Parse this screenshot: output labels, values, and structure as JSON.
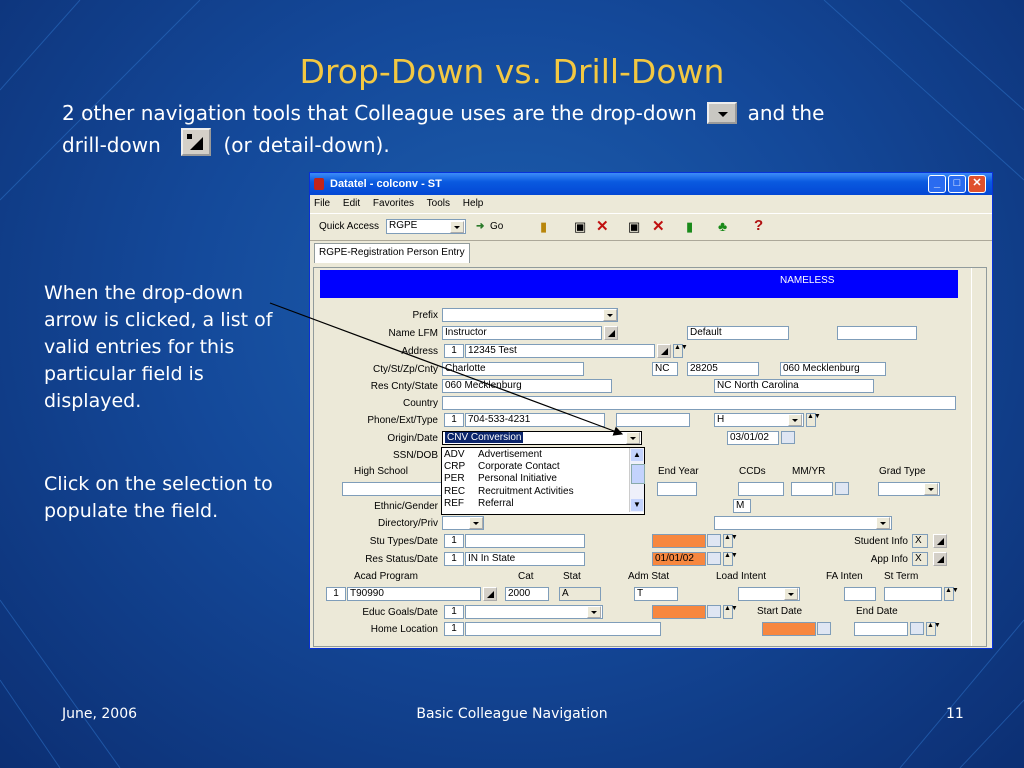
{
  "slide": {
    "title": "Drop-Down vs. Drill-Down",
    "intro_part1": "2 other navigation tools that Colleague uses are the drop-down",
    "intro_part2": "and the",
    "intro_part3": "drill-down",
    "intro_part4": "(or detail-down).",
    "side_text1": "When the drop-down arrow is clicked, a list of valid entries for this particular field is displayed.",
    "side_text2": "Click on the selection to populate the field.",
    "footer_left": "June, 2006",
    "footer_center": "Basic Colleague Navigation",
    "footer_right": "11"
  },
  "window": {
    "title": "Datatel - colconv - ST",
    "menu": [
      "File",
      "Edit",
      "Favorites",
      "Tools",
      "Help"
    ],
    "quick_access_label": "Quick Access",
    "quick_access_value": "RGPE",
    "go_label": "Go",
    "tab_label": "RGPE-Registration Person Entry",
    "banner_text": "NAMELESS"
  },
  "form": {
    "labels": {
      "prefix": "Prefix",
      "name": "Name LFM",
      "address": "Address",
      "city": "Cty/St/Zp/Cnty",
      "res_cnty": "Res Cnty/State",
      "country": "Country",
      "phone": "Phone/Ext/Type",
      "origin": "Origin/Date",
      "ssn": "SSN/DOB",
      "high_school": "High School",
      "end_year": "End Year",
      "ccds": "CCDs",
      "mmyr": "MM/YR",
      "grad_type": "Grad Type",
      "ethnic": "Ethnic/Gender",
      "directory": "Directory/Priv",
      "stu_types": "Stu Types/Date",
      "student_info": "Student Info",
      "res_status": "Res Status/Date",
      "app_info": "App Info",
      "acad_program": "Acad Program",
      "cat": "Cat",
      "stat": "Stat",
      "adm_stat": "Adm Stat",
      "load_intent": "Load Intent",
      "fa_inten": "FA Inten",
      "st_term": "St Term",
      "educ_goals": "Educ Goals/Date",
      "start_date": "Start Date",
      "end_date": "End Date",
      "home_location": "Home Location"
    },
    "values": {
      "name": "Instructor",
      "name_default": "Default",
      "address_num": "1",
      "address": "12345 Test",
      "city": "Charlotte",
      "state": "NC",
      "zip": "28205",
      "county": "060 Mecklenburg",
      "res_cnty": "060    Mecklenburg",
      "res_state": "NC North Carolina",
      "phone_num": "1",
      "phone": "704-533-4231",
      "phone_type": "H",
      "origin": "CNV    Conversion",
      "origin_date": "03/01/02",
      "gender": "M",
      "stu_types_num": "1",
      "student_info_flag": "X",
      "res_status_num": "1",
      "res_status": "IN    In State",
      "res_status_date": "01/01/02",
      "app_info_flag": "X",
      "acad_num": "1",
      "acad_program": "T90990",
      "cat": "2000",
      "stat": "A",
      "adm_stat": "T",
      "educ_num": "1",
      "home_num": "1"
    },
    "dropdown_options": [
      {
        "code": "ADV",
        "desc": "Advertisement"
      },
      {
        "code": "CRP",
        "desc": "Corporate Contact"
      },
      {
        "code": "PER",
        "desc": "Personal Initiative"
      },
      {
        "code": "REC",
        "desc": "Recruitment Activities"
      },
      {
        "code": "REF",
        "desc": "Referral"
      }
    ]
  },
  "colors": {
    "title": "#f3c842",
    "banner": "#0000ff",
    "highlight": "#f7873f",
    "selected": "#0a246a"
  }
}
